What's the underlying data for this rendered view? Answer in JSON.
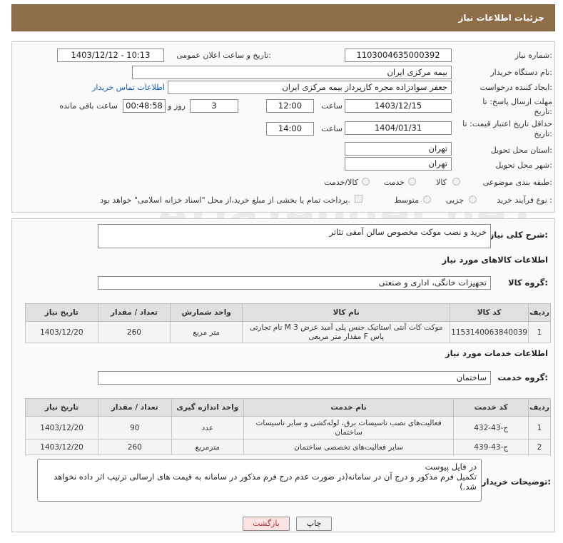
{
  "header": {
    "title": "جزئیات اطلاعات نیاز"
  },
  "form": {
    "need_number": {
      "label": "شماره نیاز:",
      "value": "1103004635000392"
    },
    "announce_datetime": {
      "label": "تاریخ و ساعت اعلان عمومی:",
      "value": "1403/12/12 - 10:13"
    },
    "buyer_org": {
      "label": "نام دستگاه خریدار:",
      "value": "بیمه مرکزی ایران"
    },
    "creator": {
      "label": "ایجاد کننده درخواست:",
      "value": "جعفر سوادزاده مجره کارپرداز بیمه مرکزی ایران",
      "contact_link": "اطلاعات تماس خریدار"
    },
    "reply_deadline": {
      "label_line1": "مهلت ارسال پاسخ: تا",
      "label_line2": "تاریخ:",
      "date": "1403/12/15",
      "time_label": "ساعت",
      "time": "12:00",
      "days": "3",
      "days_label": "روز و",
      "remaining": "00:48:58",
      "remaining_label": "ساعت باقی مانده"
    },
    "price_validity": {
      "label_line1": "حداقل تاریخ اعتبار قیمت: تا",
      "label_line2": "تاریخ:",
      "date": "1404/01/31",
      "time_label": "ساعت",
      "time": "14:00"
    },
    "province": {
      "label": "استان محل تحویل:",
      "value": "تهران"
    },
    "city": {
      "label": "شهر محل تحویل:",
      "value": "تهران"
    },
    "category": {
      "label": "طبقه بندی موضوعی:",
      "options": [
        "کالا",
        "خدمت",
        "کالا/خدمت"
      ]
    },
    "process": {
      "label": "نوع فرآیند خرید :",
      "options": [
        "جزیی",
        "متوسط"
      ],
      "note": "پرداخت تمام یا بخشی از مبلغ خرید،از محل \"اسناد خزانه اسلامی\" خواهد بود."
    }
  },
  "description": {
    "label": "شرح کلی نیاز:",
    "value": "خرید و نصب موکت مخصوص سالن آمفی تئاتر"
  },
  "goods": {
    "section_title": "اطلاعات کالاهای مورد نیاز",
    "group_label": "گروه کالا:",
    "group_value": "تجهیزات خانگی، اداری و صنعتی",
    "headers": [
      "ردیف",
      "کد کالا",
      "نام کالا",
      "واحد شمارش",
      "تعداد / مقدار",
      "تاریخ نیاز"
    ],
    "rows": [
      {
        "idx": "1",
        "code": "1153140063840039",
        "name_l1": "موکت کات آنتی استاتیک جنس پلی آمید عرض 3 M نام تجارتی",
        "name_l2": "پاس F مقدار متر مربعی",
        "unit": "متر مربع",
        "qty": "260",
        "date": "1403/12/20"
      }
    ]
  },
  "services": {
    "section_title": "اطلاعات خدمات مورد نیاز",
    "group_label": "گروه خدمت:",
    "group_value": "ساختمان",
    "headers": [
      "ردیف",
      "کد خدمت",
      "نام خدمت",
      "واحد اندازه گیری",
      "تعداد / مقدار",
      "تاریخ نیاز"
    ],
    "rows": [
      {
        "idx": "1",
        "code": "ج-43-432",
        "name_l1": "فعالیت‌های نصب تاسیسات برق، لوله‌کشی و سایر تاسیسات",
        "name_l2": "ساختمان",
        "unit": "عدد",
        "qty": "90",
        "date": "1403/12/20"
      },
      {
        "idx": "2",
        "code": "ج-43-439",
        "name_l1": "سایر فعالیت‌های تخصصی ساختمان",
        "name_l2": "",
        "unit": "مترمربع",
        "qty": "260",
        "date": "1403/12/20"
      }
    ]
  },
  "buyer_notes": {
    "label": "توضیحات خریدار:",
    "line1": "در فایل پیوست",
    "line2": "تکمیل فرم مذکور و درج آن در سامانه(در صورت عدم درج فرم مذکور در سامانه به قیمت های ارسالی ترتیب اثر داده نخواهد",
    "line3": "شد.)"
  },
  "buttons": {
    "print": "چاپ",
    "back": "بازگشت"
  },
  "watermark": "AriaTender.neT"
}
